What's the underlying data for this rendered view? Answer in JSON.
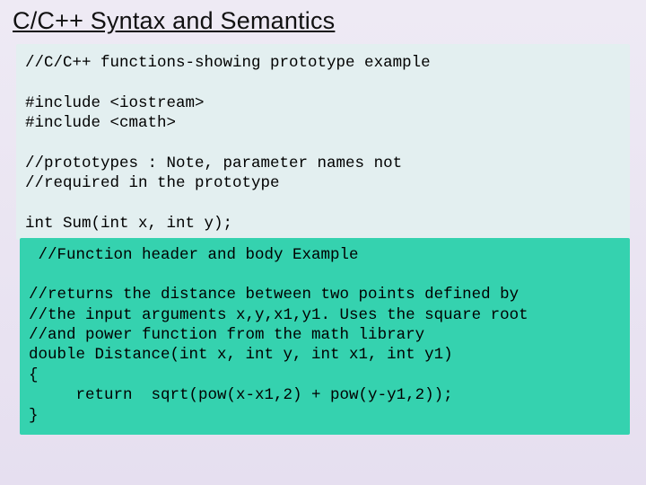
{
  "title": "C/C++ Syntax and Semantics",
  "code_top": "//C/C++ functions-showing prototype example\n\n#include <iostream>\n#include <cmath>\n\n//prototypes : Note, parameter names not\n//required in the prototype\n\nint Sum(int x, int y);",
  "code_bot": " //Function header and body Example\n\n//returns the distance between two points defined by\n//the input arguments x,y,x1,y1. Uses the square root\n//and power function from the math library\ndouble Distance(int x, int y, int x1, int y1)\n{\n     return  sqrt(pow(x-x1,2) + pow(y-y1,2));\n}"
}
